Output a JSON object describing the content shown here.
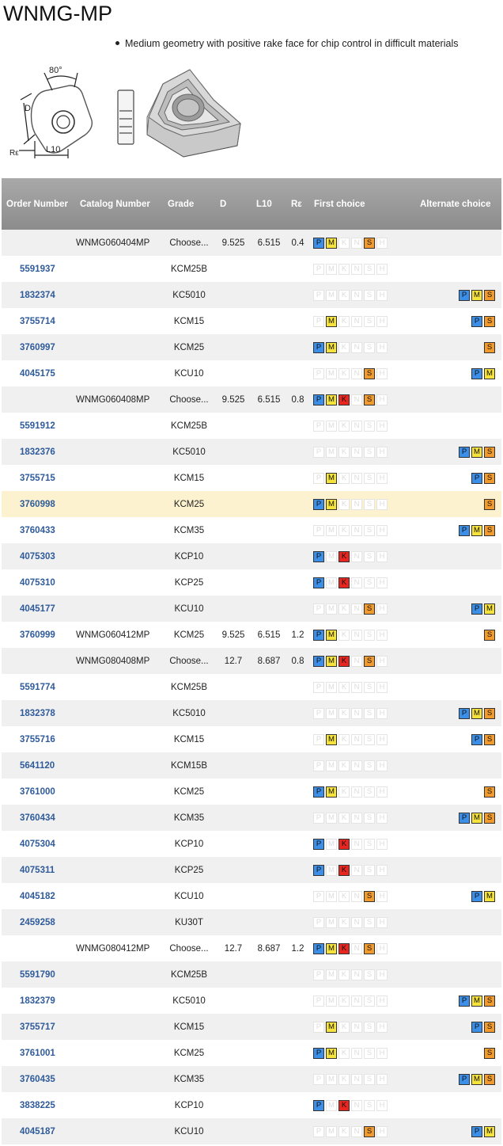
{
  "title": "WNMG-MP",
  "description": "Medium geometry with positive rake face for chip control in difficult materials",
  "drawing_labels": {
    "angle": "80°",
    "d": "D",
    "re": "Rε",
    "l10": "L10"
  },
  "columns": [
    "Order Number",
    "Catalog Number",
    "Grade",
    "D",
    "L10",
    "Rε",
    "First choice",
    "Alternate choice"
  ],
  "chip_letters": [
    "P",
    "M",
    "K",
    "N",
    "S",
    "H"
  ],
  "colors": {
    "P": "#3c8fe8",
    "M": "#f5e23a",
    "K": "#e8261f",
    "S": "#f39a2c",
    "header": "#999999",
    "highlight": "#fdf2cf",
    "order_link": "#2f5b9a"
  },
  "rows": [
    {
      "order": "",
      "catalog": "WNMG060404MP",
      "grade": "Choose...",
      "d": "9.525",
      "l10": "6.515",
      "re": "0.4",
      "first": [
        "P",
        "M",
        "S"
      ],
      "alt": []
    },
    {
      "order": "5591937",
      "catalog": "",
      "grade": "KCM25B",
      "d": "",
      "l10": "",
      "re": "",
      "first": [],
      "alt": []
    },
    {
      "order": "1832374",
      "catalog": "",
      "grade": "KC5010",
      "d": "",
      "l10": "",
      "re": "",
      "first": [],
      "alt": [
        "P",
        "M",
        "S"
      ]
    },
    {
      "order": "3755714",
      "catalog": "",
      "grade": "KCM15",
      "d": "",
      "l10": "",
      "re": "",
      "first": [
        "M"
      ],
      "alt": [
        "P",
        "S"
      ]
    },
    {
      "order": "3760997",
      "catalog": "",
      "grade": "KCM25",
      "d": "",
      "l10": "",
      "re": "",
      "first": [
        "P",
        "M"
      ],
      "alt": [
        "S"
      ]
    },
    {
      "order": "4045175",
      "catalog": "",
      "grade": "KCU10",
      "d": "",
      "l10": "",
      "re": "",
      "first": [
        "S"
      ],
      "alt": [
        "P",
        "M"
      ]
    },
    {
      "order": "",
      "catalog": "WNMG060408MP",
      "grade": "Choose...",
      "d": "9.525",
      "l10": "6.515",
      "re": "0.8",
      "first": [
        "P",
        "M",
        "K",
        "S"
      ],
      "alt": []
    },
    {
      "order": "5591912",
      "catalog": "",
      "grade": "KCM25B",
      "d": "",
      "l10": "",
      "re": "",
      "first": [],
      "alt": []
    },
    {
      "order": "1832376",
      "catalog": "",
      "grade": "KC5010",
      "d": "",
      "l10": "",
      "re": "",
      "first": [],
      "alt": [
        "P",
        "M",
        "S"
      ]
    },
    {
      "order": "3755715",
      "catalog": "",
      "grade": "KCM15",
      "d": "",
      "l10": "",
      "re": "",
      "first": [
        "M"
      ],
      "alt": [
        "P",
        "S"
      ]
    },
    {
      "order": "3760998",
      "catalog": "",
      "grade": "KCM25",
      "d": "",
      "l10": "",
      "re": "",
      "first": [
        "P",
        "M"
      ],
      "alt": [
        "S"
      ],
      "highlight": true
    },
    {
      "order": "3760433",
      "catalog": "",
      "grade": "KCM35",
      "d": "",
      "l10": "",
      "re": "",
      "first": [],
      "alt": [
        "P",
        "M",
        "S"
      ]
    },
    {
      "order": "4075303",
      "catalog": "",
      "grade": "KCP10",
      "d": "",
      "l10": "",
      "re": "",
      "first": [
        "P",
        "K"
      ],
      "alt": []
    },
    {
      "order": "4075310",
      "catalog": "",
      "grade": "KCP25",
      "d": "",
      "l10": "",
      "re": "",
      "first": [
        "P",
        "K"
      ],
      "alt": []
    },
    {
      "order": "4045177",
      "catalog": "",
      "grade": "KCU10",
      "d": "",
      "l10": "",
      "re": "",
      "first": [
        "S"
      ],
      "alt": [
        "P",
        "M"
      ]
    },
    {
      "order": "3760999",
      "catalog": "WNMG060412MP",
      "grade": "KCM25",
      "d": "9.525",
      "l10": "6.515",
      "re": "1.2",
      "first": [
        "P",
        "M"
      ],
      "alt": [
        "S"
      ]
    },
    {
      "order": "",
      "catalog": "WNMG080408MP",
      "grade": "Choose...",
      "d": "12.7",
      "l10": "8.687",
      "re": "0.8",
      "first": [
        "P",
        "M",
        "K",
        "S"
      ],
      "alt": []
    },
    {
      "order": "5591774",
      "catalog": "",
      "grade": "KCM25B",
      "d": "",
      "l10": "",
      "re": "",
      "first": [],
      "alt": []
    },
    {
      "order": "1832378",
      "catalog": "",
      "grade": "KC5010",
      "d": "",
      "l10": "",
      "re": "",
      "first": [],
      "alt": [
        "P",
        "M",
        "S"
      ]
    },
    {
      "order": "3755716",
      "catalog": "",
      "grade": "KCM15",
      "d": "",
      "l10": "",
      "re": "",
      "first": [
        "M"
      ],
      "alt": [
        "P",
        "S"
      ]
    },
    {
      "order": "5641120",
      "catalog": "",
      "grade": "KCM15B",
      "d": "",
      "l10": "",
      "re": "",
      "first": [],
      "alt": []
    },
    {
      "order": "3761000",
      "catalog": "",
      "grade": "KCM25",
      "d": "",
      "l10": "",
      "re": "",
      "first": [
        "P",
        "M"
      ],
      "alt": [
        "S"
      ]
    },
    {
      "order": "3760434",
      "catalog": "",
      "grade": "KCM35",
      "d": "",
      "l10": "",
      "re": "",
      "first": [],
      "alt": [
        "P",
        "M",
        "S"
      ]
    },
    {
      "order": "4075304",
      "catalog": "",
      "grade": "KCP10",
      "d": "",
      "l10": "",
      "re": "",
      "first": [
        "P",
        "K"
      ],
      "alt": []
    },
    {
      "order": "4075311",
      "catalog": "",
      "grade": "KCP25",
      "d": "",
      "l10": "",
      "re": "",
      "first": [
        "P",
        "K"
      ],
      "alt": []
    },
    {
      "order": "4045182",
      "catalog": "",
      "grade": "KCU10",
      "d": "",
      "l10": "",
      "re": "",
      "first": [
        "S"
      ],
      "alt": [
        "P",
        "M"
      ]
    },
    {
      "order": "2459258",
      "catalog": "",
      "grade": "KU30T",
      "d": "",
      "l10": "",
      "re": "",
      "first": [],
      "alt": []
    },
    {
      "order": "",
      "catalog": "WNMG080412MP",
      "grade": "Choose...",
      "d": "12.7",
      "l10": "8.687",
      "re": "1.2",
      "first": [
        "P",
        "M",
        "K",
        "S"
      ],
      "alt": []
    },
    {
      "order": "5591790",
      "catalog": "",
      "grade": "KCM25B",
      "d": "",
      "l10": "",
      "re": "",
      "first": [],
      "alt": []
    },
    {
      "order": "1832379",
      "catalog": "",
      "grade": "KC5010",
      "d": "",
      "l10": "",
      "re": "",
      "first": [],
      "alt": [
        "P",
        "M",
        "S"
      ]
    },
    {
      "order": "3755717",
      "catalog": "",
      "grade": "KCM15",
      "d": "",
      "l10": "",
      "re": "",
      "first": [
        "M"
      ],
      "alt": [
        "P",
        "S"
      ]
    },
    {
      "order": "3761001",
      "catalog": "",
      "grade": "KCM25",
      "d": "",
      "l10": "",
      "re": "",
      "first": [
        "P",
        "M"
      ],
      "alt": [
        "S"
      ]
    },
    {
      "order": "3760435",
      "catalog": "",
      "grade": "KCM35",
      "d": "",
      "l10": "",
      "re": "",
      "first": [],
      "alt": [
        "P",
        "M",
        "S"
      ]
    },
    {
      "order": "3838225",
      "catalog": "",
      "grade": "KCP10",
      "d": "",
      "l10": "",
      "re": "",
      "first": [
        "P",
        "K"
      ],
      "alt": []
    },
    {
      "order": "4045187",
      "catalog": "",
      "grade": "KCU10",
      "d": "",
      "l10": "",
      "re": "",
      "first": [
        "S"
      ],
      "alt": [
        "P",
        "M"
      ]
    }
  ]
}
